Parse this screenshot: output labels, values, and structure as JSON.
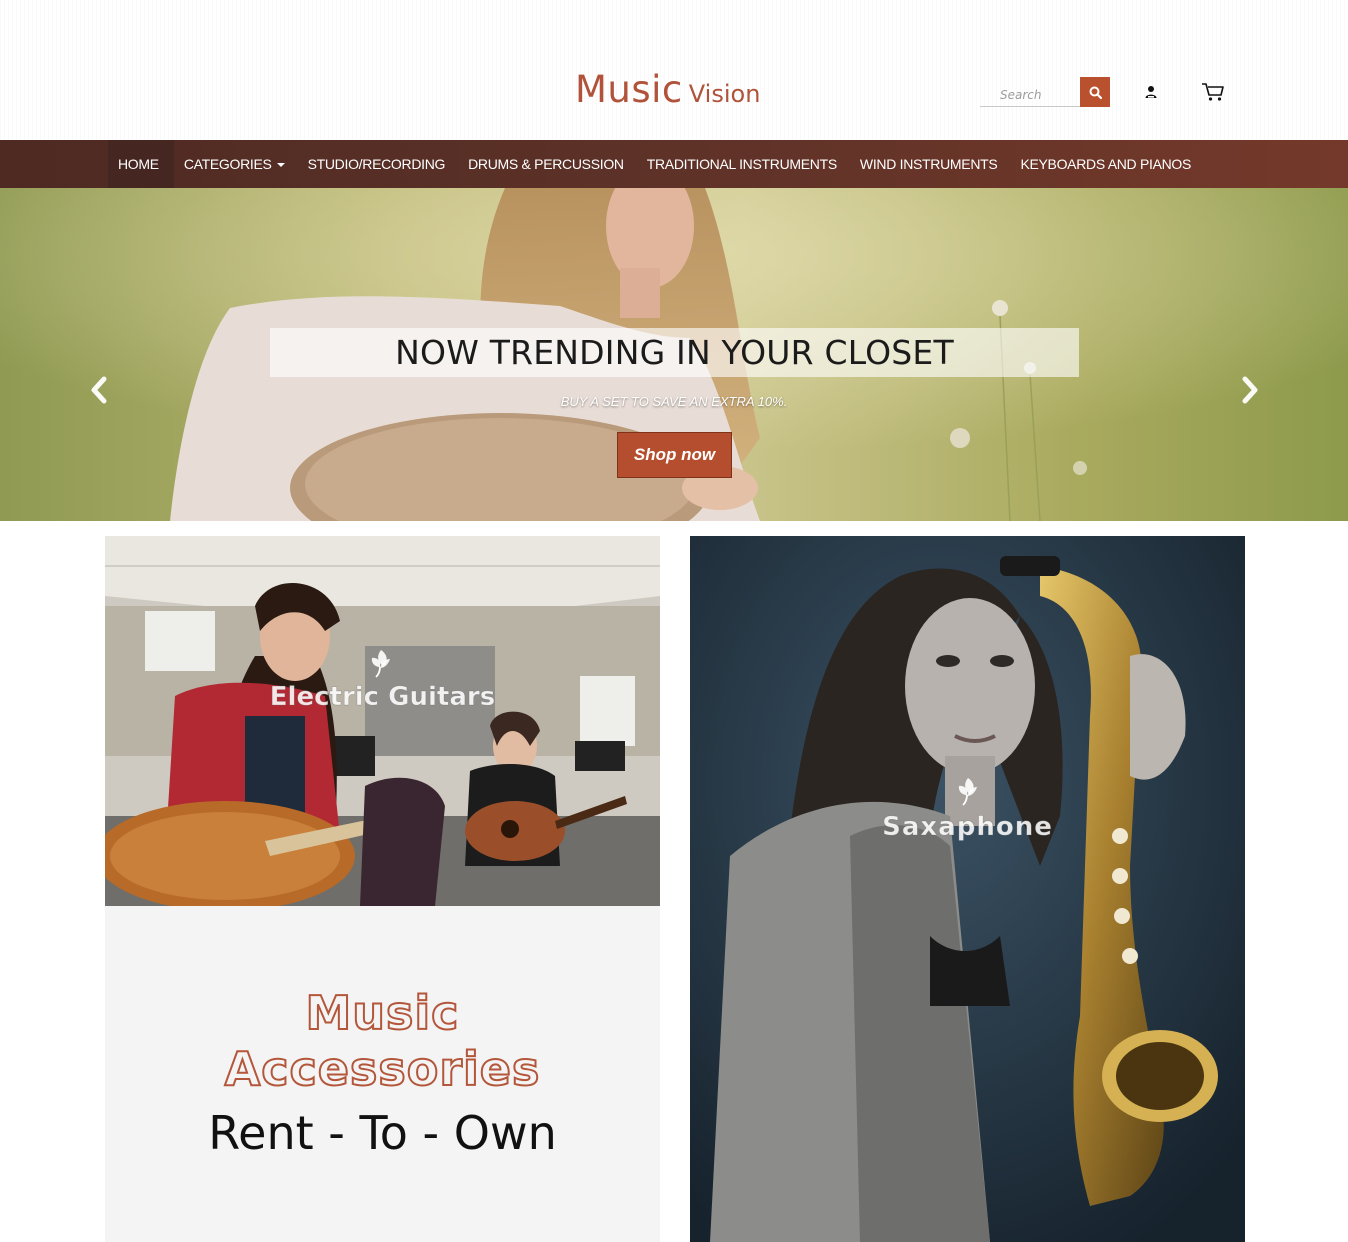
{
  "header": {
    "brand_main": "Music",
    "brand_sub": "Vision",
    "search_placeholder": "Search",
    "icons": {
      "search": "search-icon",
      "user": "user-icon",
      "cart": "cart-icon"
    }
  },
  "nav": {
    "items": [
      {
        "label": "HOME"
      },
      {
        "label": "CATEGORIES"
      },
      {
        "label": "STUDIO/RECORDING"
      },
      {
        "label": "DRUMS & PERCUSSION"
      },
      {
        "label": "TRADITIONAL INSTRUMENTS"
      },
      {
        "label": "WIND INSTRUMENTS"
      },
      {
        "label": "KEYBOARDS AND PIANOS"
      }
    ]
  },
  "hero": {
    "title": "NOW TRENDING IN YOUR CLOSET",
    "subtitle": "BUY A SET TO SAVE AN EXTRA 10%.",
    "cta": "Shop now"
  },
  "tiles": {
    "guitars_label": "Electric Guitars",
    "sax_label": "Saxaphone"
  },
  "accessories": {
    "line1": "Music",
    "line2": "Accessories",
    "line3": "Rent - To - Own"
  },
  "colors": {
    "brand": "#b0533a",
    "nav_bg": "#5c3127",
    "cta_bg": "#b44e2e"
  }
}
